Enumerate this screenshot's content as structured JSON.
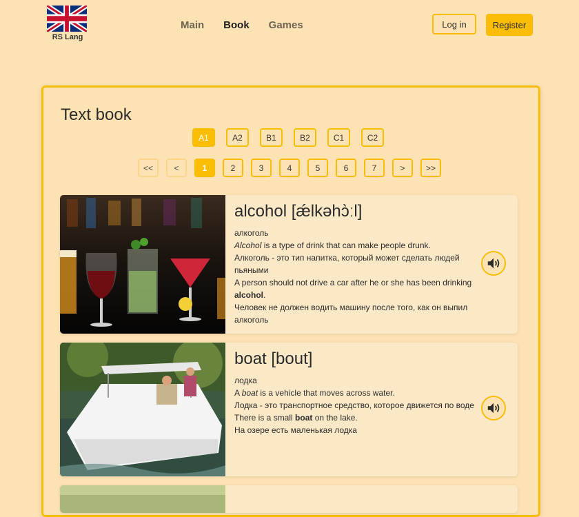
{
  "logo": {
    "text": "RS Lang"
  },
  "nav": {
    "items": [
      "Main",
      "Book",
      "Games"
    ]
  },
  "auth": {
    "login": "Log in",
    "register": "Register"
  },
  "book": {
    "title": "Text book",
    "levels": [
      "A1",
      "A2",
      "B1",
      "B2",
      "C1",
      "C2"
    ],
    "active_level": "A1",
    "pages": [
      "<<",
      "<",
      "1",
      "2",
      "3",
      "4",
      "5",
      "6",
      "7",
      ">",
      ">>"
    ],
    "active_page": "1"
  },
  "words": [
    {
      "heading": "alcohol [ǽlkəhɔ̀ːl]",
      "translation": "алкоголь",
      "meaning_parts": [
        "Alcohol",
        " is a type of drink that can make people drunk."
      ],
      "meaning_translation": "Алкоголь - это тип напитка, который может сделать людей пьяными",
      "example_parts": [
        "A person should not drive a car after he or she has been drinking ",
        "alcohol",
        "."
      ],
      "example_translation": "Человек не должен водить машину после того, как он выпил алкоголь",
      "image_icon": "drinks-photo"
    },
    {
      "heading": "boat [bout]",
      "translation": "лодка",
      "meaning_parts": [
        "A ",
        "boat",
        " is a vehicle that moves across water."
      ],
      "meaning_translation": "Лодка - это транспортное средство, которое движется по воде",
      "example_parts": [
        "There is a small ",
        "boat",
        " on the lake."
      ],
      "example_translation": "На озере есть маленькая лодка",
      "image_icon": "boat-photo"
    }
  ],
  "icons": {
    "audio": "speaker-icon",
    "flag": "uk-flag-icon"
  },
  "colors": {
    "accent": "#fbbd05",
    "background": "#fde3b3",
    "card": "#fbe8c6"
  }
}
